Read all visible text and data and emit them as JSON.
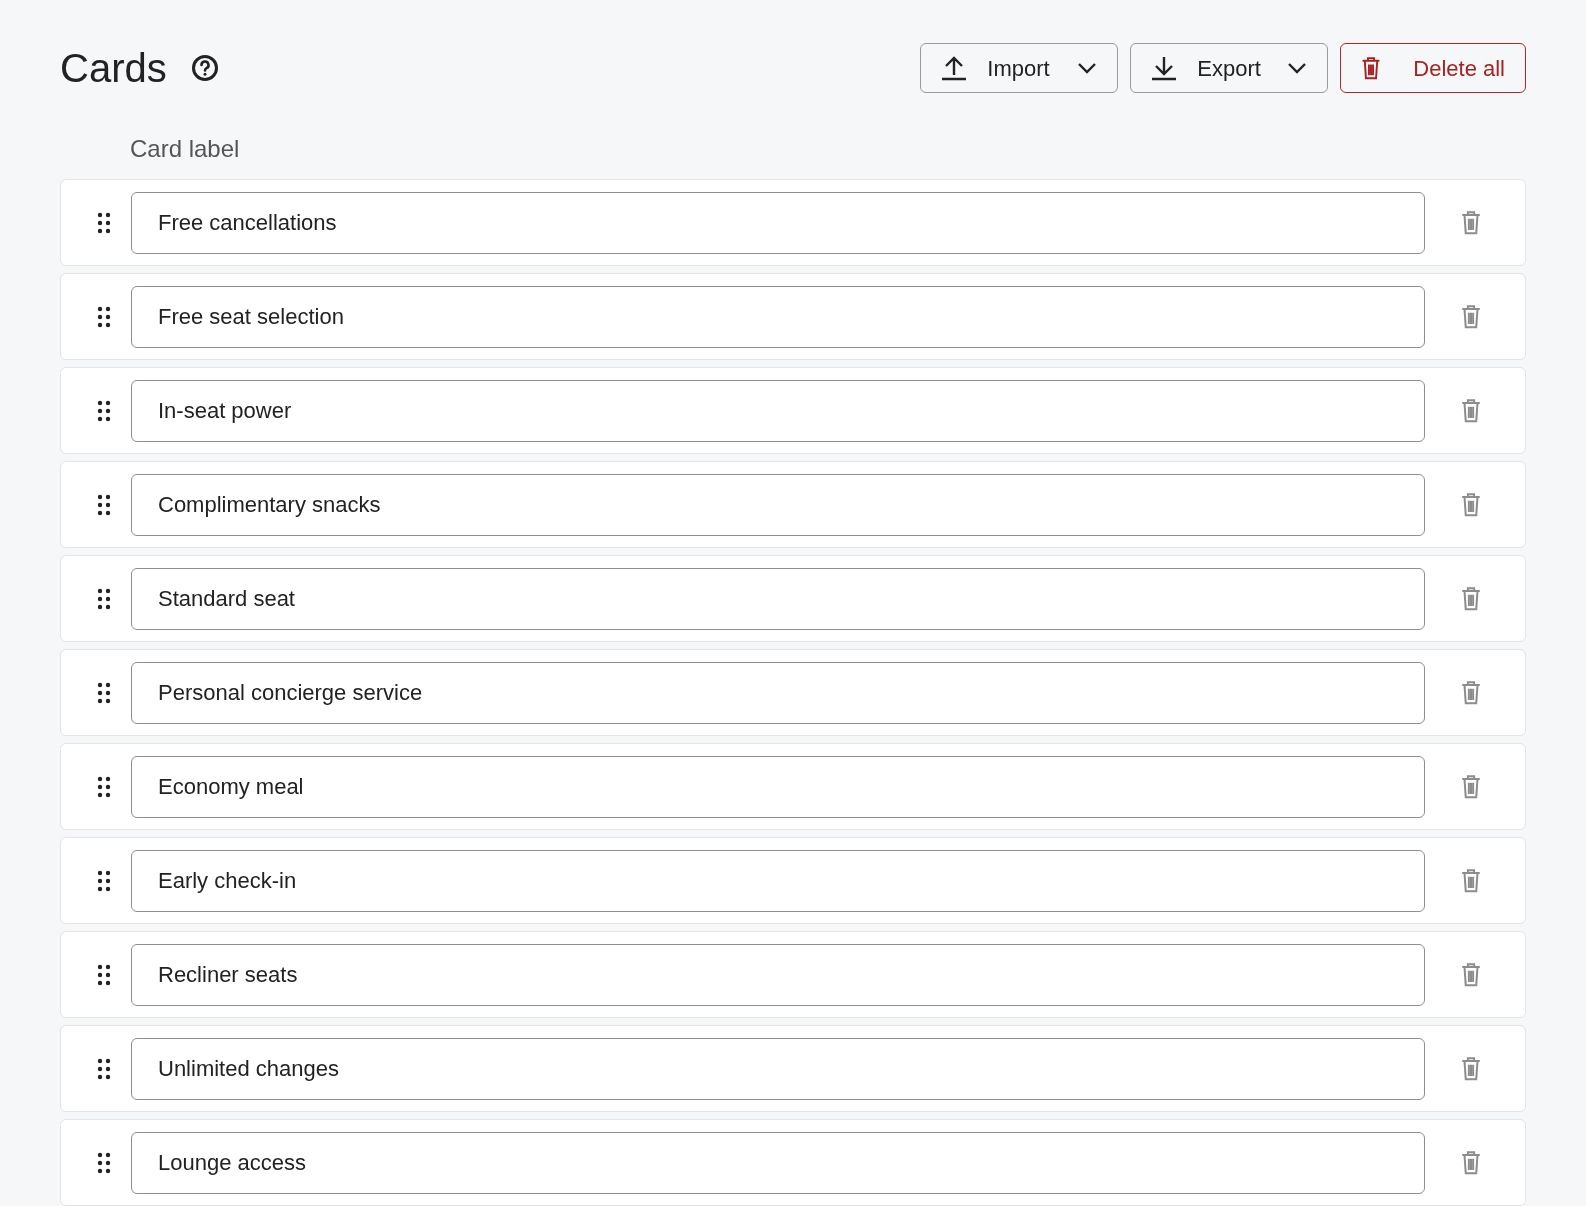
{
  "header": {
    "title": "Cards",
    "buttons": [
      {
        "kind": "import",
        "label": "Import"
      },
      {
        "kind": "export",
        "label": "Export"
      },
      {
        "kind": "delete",
        "label": "Delete all"
      }
    ]
  },
  "column_label": "Card label",
  "cards": [
    {
      "value": "Free cancellations"
    },
    {
      "value": "Free seat selection"
    },
    {
      "value": "In-seat power"
    },
    {
      "value": "Complimentary snacks"
    },
    {
      "value": "Standard seat"
    },
    {
      "value": "Personal concierge service"
    },
    {
      "value": "Economy meal"
    },
    {
      "value": "Early check-in"
    },
    {
      "value": "Recliner seats"
    },
    {
      "value": "Unlimited changes"
    },
    {
      "value": "Lounge access"
    }
  ]
}
